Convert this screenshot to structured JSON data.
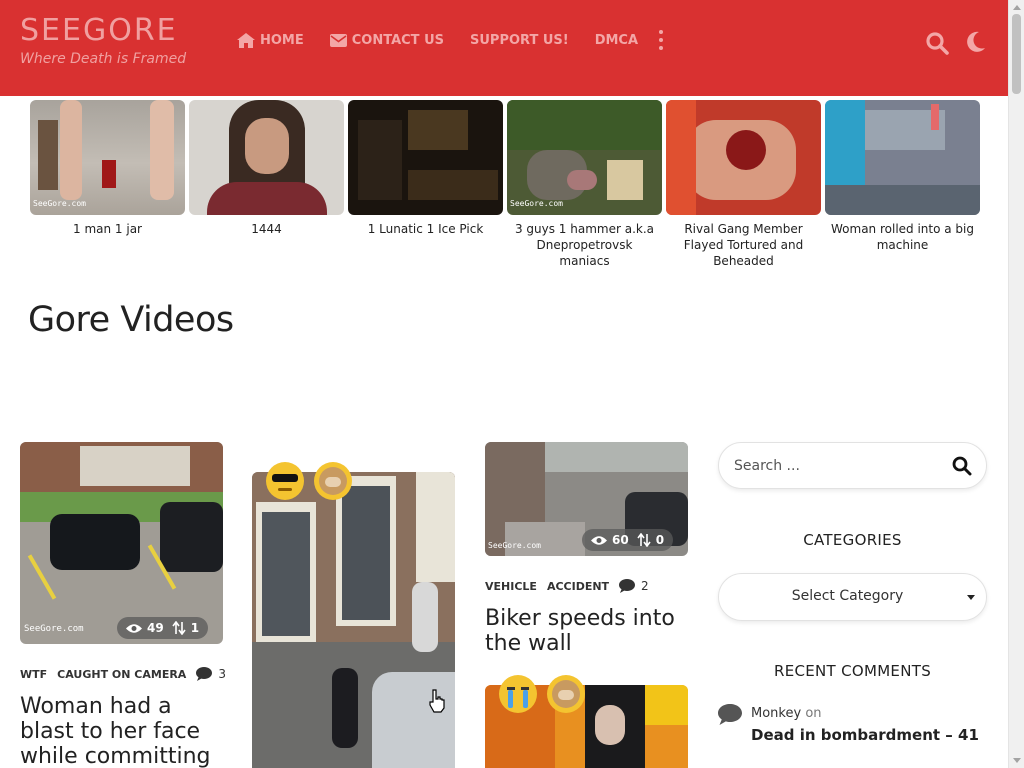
{
  "site": {
    "name": "SEEGORE",
    "tagline": "Where Death is Framed"
  },
  "nav": {
    "items": [
      {
        "label": "HOME",
        "icon": "home-icon"
      },
      {
        "label": "CONTACT US",
        "icon": "envelope-icon"
      },
      {
        "label": "SUPPORT US!",
        "icon": ""
      },
      {
        "label": "DMCA",
        "icon": ""
      }
    ],
    "more_icon": "more-vertical-icon",
    "search_icon": "search-icon",
    "theme_icon": "moon-icon"
  },
  "colors": {
    "header_bg": "#d93131",
    "header_text": "#f3a6a6"
  },
  "featured": [
    {
      "caption": "1 man 1 jar",
      "watermark": "SeeGore.com"
    },
    {
      "caption": "1444",
      "watermark": ""
    },
    {
      "caption": "1 Lunatic 1 Ice Pick",
      "watermark": ""
    },
    {
      "caption": "3 guys 1 hammer a.k.a Dnepropetrovsk maniacs",
      "watermark": "SeeGore.com"
    },
    {
      "caption": "Rival Gang Member Flayed Tortured and Beheaded",
      "watermark": ""
    },
    {
      "caption": "Woman rolled into a big machine",
      "watermark": ""
    }
  ],
  "section": {
    "title": "Gore Videos"
  },
  "posts": [
    {
      "title": "Woman had a blast to her face while committing arson",
      "categories": [
        "WTF",
        "CAUGHT ON CAMERA"
      ],
      "comments": "3",
      "views": "49",
      "shares": "1",
      "watermark": "SeeGore.com"
    },
    {
      "title": "",
      "reactions": [
        "cool-face-emoji",
        "cat-emoji"
      ]
    },
    {
      "title": "Biker speeds into the wall",
      "categories": [
        "VEHICLE",
        "ACCIDENT"
      ],
      "comments": "2",
      "views": "60",
      "shares": "0",
      "watermark": "SeeGore.com"
    },
    {
      "title": "",
      "reactions": [
        "crying-face-emoji",
        "cat-emoji"
      ]
    }
  ],
  "sidebar": {
    "search_placeholder": "Search ...",
    "categories_heading": "CATEGORIES",
    "select_value": "Select Category",
    "recent_heading": "RECENT COMMENTS",
    "recent_comments": [
      {
        "author": "Monkey",
        "on": "on",
        "post": "Dead in bombardment – 41"
      }
    ]
  }
}
